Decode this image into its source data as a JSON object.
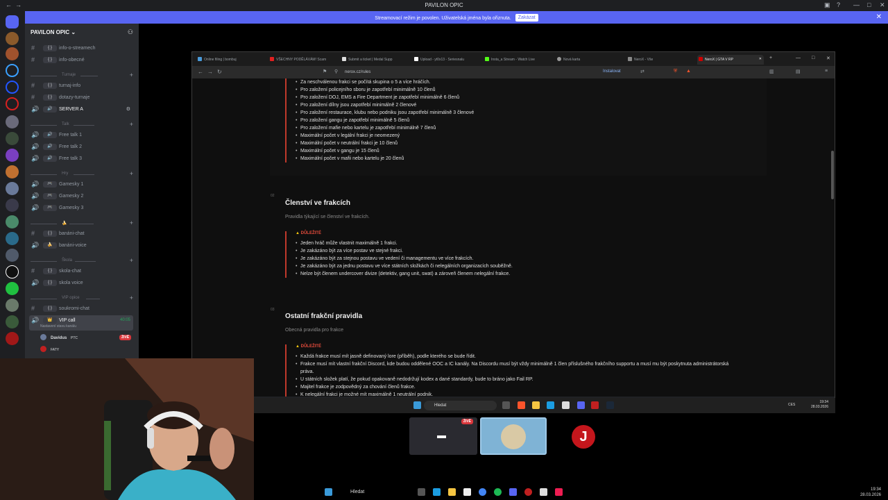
{
  "window": {
    "title": "PAVILON OPIC"
  },
  "banner": {
    "text": "Streamovací režim je povolen. Uživatelská jména byla ořiznuta.",
    "button": "Zakázat"
  },
  "guild": {
    "name": "PAVILON OPIC"
  },
  "channels": [
    {
      "label": "info-o-streamech",
      "type": "text"
    },
    {
      "label": "info-obecné",
      "type": "text"
    },
    {
      "label": "turnaj-info",
      "type": "text"
    },
    {
      "label": "dotazy-turnaje",
      "type": "text"
    },
    {
      "label": "SERVER A",
      "type": "voice"
    },
    {
      "label": "Free talk 1",
      "type": "voice"
    },
    {
      "label": "Free talk 2",
      "type": "voice"
    },
    {
      "label": "Free talk 3",
      "type": "voice"
    },
    {
      "label": "Gamesky 1",
      "type": "voice"
    },
    {
      "label": "Gamesky 2",
      "type": "voice"
    },
    {
      "label": "Gamesky 3",
      "type": "voice"
    },
    {
      "label": "banáni-chat",
      "type": "text"
    },
    {
      "label": "banáni-voice",
      "type": "voice"
    },
    {
      "label": "skola-chat",
      "type": "text"
    },
    {
      "label": "skola voice",
      "type": "voice"
    },
    {
      "label": "soukromi-chat",
      "type": "text"
    },
    {
      "label": "VIP call",
      "type": "voice"
    }
  ],
  "categories": [
    "Turnaje",
    "Talk",
    "Hry",
    "Škola",
    "VIP opice"
  ],
  "vip_call": {
    "status": "Nastavení stavu kanálu",
    "timer": "40:05",
    "user1": "Davidus",
    "user1_tag": "PTC",
    "user1_badge": "ŽIVĚ",
    "user2": "FATY"
  },
  "browser": {
    "tabs": [
      "Online filing | bombuj",
      "VŠECHNY PODĚLÁVÁM! Scam",
      "Submit a ticket | Medal Supp",
      "Upload - yt0x13 - Seriesnalu",
      "Insta_a Stream - Watch Live",
      "Nová karta",
      "NeroX - Vše",
      "NeroX | GTA V RP"
    ],
    "url": "nerox.cz/rules",
    "install": "Instalovat"
  },
  "page": {
    "section1_rules": [
      "Za neschválenou frakci se počítá skupina o 5 a více hráčích.",
      "Pro založení policejního sboru je zapotřebí minimálně 10 členů",
      "Pro založení DOJ, EMS a Fire Department je zapotřebí minimálně 6 členů",
      "Pro založení dílny jsou zapotřebí minimálně 2 členové",
      "Pro založení restaurace, klubu nebo podniku jsou zapotřebí minimálně 3 členové",
      "Pro založení gangu je zapotřebí minimálně 5 členů",
      "Pro založení mafie nebo kartelu je zapotřebí minimálně 7 členů",
      "Maximální počet v legální frakci je neomezený",
      "Maximální počet v neutrální frakci je 10 členů",
      "Maximální počet v gangu je 15 členů",
      "Maximální počet v mafii nebo kartelu je 20 členů"
    ],
    "s2_num": "02",
    "s2_title": "Členství ve frakcích",
    "s2_sub": "Pravidla týkající se členství ve frakcích.",
    "important": "DŮLEŽITÉ",
    "section2_rules": [
      "Jeden hráč může vlastnit maximálně 1 frakci.",
      "Je zakázáno být za více postav ve stejné frakci.",
      "Je zakázáno být za stejnou postavu ve vedení či managementu ve více frakcích.",
      "Je zakázáno být za jednu postavu ve více státních složkách či nelegálních organizacích souběžně.",
      "Nelze být členem undercover divize (detektiv, gang unit, swat) a zároveň členem nelegální frakce."
    ],
    "s3_num": "03",
    "s3_title": "Ostatní frakční pravidla",
    "s3_sub": "Obecná pravidla pro frakce",
    "section3_rules": [
      "Každá frakce musí mít jasně definovaný lore (příběh), podle kterého se bude řídit.",
      "Frakce musí mít vlastní frakční Discord, kde budou oddělené OOC a IC kanály. Na Discordu musí být vždy minimálně 1 člen příslušného frakčního supportu a musí mu být poskytnuta administrátorská práva.",
      "U státních složek platí, že pokud opakovaně nedodržují kodex a dané standardy, bude to bráno jako Fail RP.",
      "Majitel frakce je zodpovědný za chování členů frakce.",
      "K nelegální frakci je možné mít maximálně 1 neutrální podnik."
    ]
  },
  "inner_taskbar": {
    "search": "Hledat",
    "lang": "CES",
    "time": "19:34",
    "date": "28.03.2026"
  },
  "thumb_badge": "ŽIVĚ",
  "taskbar": {
    "search": "Hledat",
    "time": "19:34",
    "date": "28.03.2026"
  }
}
